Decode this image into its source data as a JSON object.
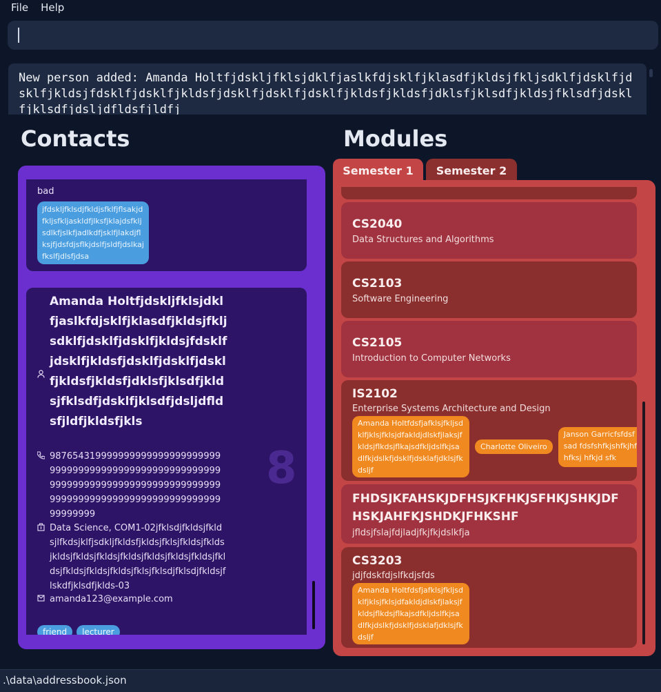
{
  "menu": {
    "file": "File",
    "help": "Help"
  },
  "command": {
    "value": ""
  },
  "result": {
    "text": "New person added: Amanda Holtfjdskljfklsjdklfjaslkfdjsklfjklasdfjkldsjfkljsdklfjdsklfjdsklfjkldsjfdsklfjdsklfjkldsfjdsklfjdsklfjdsklfjkldsfjkldsfjdklsfjklsdfjkldsjfklsdfjdsklfjklsdfjdsljdfldsfjldfj"
  },
  "contacts": {
    "title": "Contacts",
    "prev_card": {
      "remark": "bad",
      "tag": "jfdskljfklsdjfkldjsfklfjflsakjdfkljsfkljaskldfjlksfjklajdsfkljsdlkfjslkfjadlkdfjsklfjlakdjflksjfjdsfdjsflkjdslfjsldfjdslkajfkslfjdlsfjdsa"
    },
    "card": {
      "name": "Amanda Holtfjdskljfklsjdklfjaslkfdjsklfjklasdfjkldsjfkljsdklfjdsklfjdsklfjkldsjfdsklfjdsklfjkldsfjdsklfjdsklfjdsklfjkldsfjkldsfjdklsfjklsdfjkldsjfklsdfjdsklfjklsdfjdsljdfldsfjldfjkldsfjkls",
      "phone": "98765431999999999999999999999999999999999999999999999999999999999999999999999999999999999999999999999999999999999999999999999999",
      "department": "Data Science, COM1-02jfklsdjfkldsjfkldsjlfkdsjklfjsdkljfkldsfjkldsjfklsjfkldsjfkldsjkldsjfkldsjfkldsjfkldsjfkldsjfkldsjfkldsjfkldsjfkldsjfkldsjfkldsjfklsjfklsdjfklsdjfkldsjflskdfjklsdfjklds-03",
      "email": "amanda123@example.com",
      "index": "8",
      "tags": [
        "friend",
        "lecturer"
      ]
    }
  },
  "modules": {
    "title": "Modules",
    "tabs": [
      "Semester 1",
      "Semester 2"
    ],
    "items": [
      {
        "code": "CS2040",
        "title": "Data Structures and Algorithms"
      },
      {
        "code": "CS2103",
        "title": "Software Engineering"
      },
      {
        "code": "CS2105",
        "title": "Introduction to Computer Networks"
      },
      {
        "code": "IS2102",
        "title": "Enterprise Systems Architecture and Design",
        "tags": [
          "Amanda Holtfdsfjafklsjfkljsdklfjklsjfklsjdfakldjdlskfjlaksjfkldsjflkdsjflkajsdfkljdslfkjsadlfkjdslkfjdsklfjdsklafjdklsjfkdsljf",
          "Charlotte Oliveiro",
          "Janson Garricfsfdsf sfasad fdsfshfkjshfkjhfkjs hfksj hfkjd sfk"
        ]
      },
      {
        "code": "FHDSJKFAHSKJDFHSJKFHKJSFHKJSHKJDFHSKJAHFKJSHDKJFHKSHF",
        "title": "jfldsjfslajfdjladjfkjfkjdslkfja"
      },
      {
        "code": "CS3203",
        "title": "jdjfdskfdjslfkdjsfds",
        "tags": [
          "Amanda Holtfdsfjafklsjfkljsdklfjklsjfklsjdfakldjdlskfjlaksjfkldsjflkdsjflkajsdfkljdslfkjsadlfkjdslkfjdsklfjdsklafjdklsjfkdsljf"
        ]
      }
    ]
  },
  "status": {
    "path": ".\\data\\addressbook.json"
  },
  "colors": {
    "background": "#0d1629",
    "contacts_panel": "#6a2fce",
    "contact_card": "#2e1466",
    "modules_panel": "#c44545",
    "tag_blue": "#4a9ee0",
    "tag_orange": "#f0891f"
  },
  "icons": {
    "name": "person-icon",
    "phone": "phone-icon",
    "department": "building-icon",
    "email": "mail-icon"
  }
}
